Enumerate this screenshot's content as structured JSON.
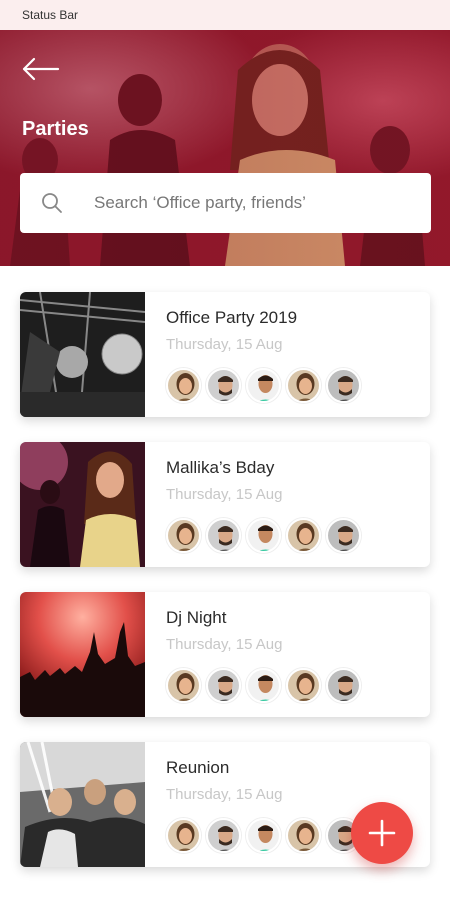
{
  "status_bar": {
    "label": "Status Bar"
  },
  "header": {
    "title": "Parties",
    "back_icon": "arrow-left-icon"
  },
  "search": {
    "placeholder": "Search ‘Office party, friends’",
    "icon": "search-icon"
  },
  "parties": [
    {
      "title": "Office Party 2019",
      "date": "Thursday, 15 Aug"
    },
    {
      "title": "Mallika’s Bday",
      "date": "Thursday, 15 Aug"
    },
    {
      "title": "Dj Night",
      "date": "Thursday, 15 Aug"
    },
    {
      "title": "Reunion",
      "date": "Thursday, 15 Aug"
    }
  ],
  "fab": {
    "icon": "plus-icon"
  },
  "colors": {
    "accent": "#ee4a45",
    "hero": "#a11e32",
    "date_text": "#c7c7c7"
  }
}
